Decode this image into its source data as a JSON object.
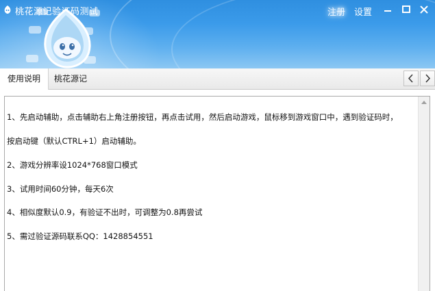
{
  "window": {
    "title": "桃花源记验证码测试",
    "register_label": "注册",
    "settings_label": "设置"
  },
  "tabs": [
    {
      "label": "使用说明",
      "active": true
    },
    {
      "label": "桃花源记",
      "active": false
    }
  ],
  "instructions": [
    "1、先启动辅助，点击辅助右上角注册按钮，再点击试用，然后启动游戏，鼠标移到游戏窗口中，遇到验证码时，",
    "按启动键（默认CTRL+1）启动辅助。",
    "2、游戏分辨率设1024*768窗口模式",
    "3、试用时间60分钟，每天6次",
    "4、相似度默认0.9，有验证不出时，可调整为0.8再尝试",
    "5、需过验证源码联系QQ：1428854551"
  ],
  "colors": {
    "header_top": "#2f8fe0",
    "header_bottom": "#8cc7f3",
    "tab_bg": "#ececec"
  },
  "icons": {
    "app": "app-logo-icon",
    "minimize": "minimize-icon",
    "maximize": "maximize-icon",
    "close": "close-icon",
    "prev": "chevron-left-icon",
    "next": "chevron-right-icon",
    "scroll_up": "scroll-up-arrow-icon"
  }
}
